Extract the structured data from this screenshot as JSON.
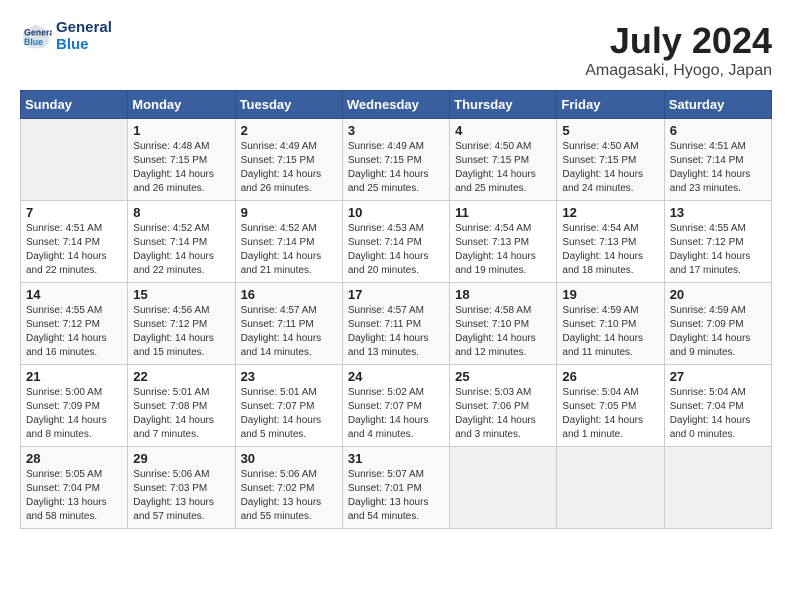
{
  "header": {
    "logo_line1": "General",
    "logo_line2": "Blue",
    "title": "July 2024",
    "location": "Amagasaki, Hyogo, Japan"
  },
  "days_of_week": [
    "Sunday",
    "Monday",
    "Tuesday",
    "Wednesday",
    "Thursday",
    "Friday",
    "Saturday"
  ],
  "weeks": [
    [
      {
        "day": "",
        "sunrise": "",
        "sunset": "",
        "daylight": ""
      },
      {
        "day": "1",
        "sunrise": "Sunrise: 4:48 AM",
        "sunset": "Sunset: 7:15 PM",
        "daylight": "Daylight: 14 hours and 26 minutes."
      },
      {
        "day": "2",
        "sunrise": "Sunrise: 4:49 AM",
        "sunset": "Sunset: 7:15 PM",
        "daylight": "Daylight: 14 hours and 26 minutes."
      },
      {
        "day": "3",
        "sunrise": "Sunrise: 4:49 AM",
        "sunset": "Sunset: 7:15 PM",
        "daylight": "Daylight: 14 hours and 25 minutes."
      },
      {
        "day": "4",
        "sunrise": "Sunrise: 4:50 AM",
        "sunset": "Sunset: 7:15 PM",
        "daylight": "Daylight: 14 hours and 25 minutes."
      },
      {
        "day": "5",
        "sunrise": "Sunrise: 4:50 AM",
        "sunset": "Sunset: 7:15 PM",
        "daylight": "Daylight: 14 hours and 24 minutes."
      },
      {
        "day": "6",
        "sunrise": "Sunrise: 4:51 AM",
        "sunset": "Sunset: 7:14 PM",
        "daylight": "Daylight: 14 hours and 23 minutes."
      }
    ],
    [
      {
        "day": "7",
        "sunrise": "Sunrise: 4:51 AM",
        "sunset": "Sunset: 7:14 PM",
        "daylight": "Daylight: 14 hours and 22 minutes."
      },
      {
        "day": "8",
        "sunrise": "Sunrise: 4:52 AM",
        "sunset": "Sunset: 7:14 PM",
        "daylight": "Daylight: 14 hours and 22 minutes."
      },
      {
        "day": "9",
        "sunrise": "Sunrise: 4:52 AM",
        "sunset": "Sunset: 7:14 PM",
        "daylight": "Daylight: 14 hours and 21 minutes."
      },
      {
        "day": "10",
        "sunrise": "Sunrise: 4:53 AM",
        "sunset": "Sunset: 7:14 PM",
        "daylight": "Daylight: 14 hours and 20 minutes."
      },
      {
        "day": "11",
        "sunrise": "Sunrise: 4:54 AM",
        "sunset": "Sunset: 7:13 PM",
        "daylight": "Daylight: 14 hours and 19 minutes."
      },
      {
        "day": "12",
        "sunrise": "Sunrise: 4:54 AM",
        "sunset": "Sunset: 7:13 PM",
        "daylight": "Daylight: 14 hours and 18 minutes."
      },
      {
        "day": "13",
        "sunrise": "Sunrise: 4:55 AM",
        "sunset": "Sunset: 7:12 PM",
        "daylight": "Daylight: 14 hours and 17 minutes."
      }
    ],
    [
      {
        "day": "14",
        "sunrise": "Sunrise: 4:55 AM",
        "sunset": "Sunset: 7:12 PM",
        "daylight": "Daylight: 14 hours and 16 minutes."
      },
      {
        "day": "15",
        "sunrise": "Sunrise: 4:56 AM",
        "sunset": "Sunset: 7:12 PM",
        "daylight": "Daylight: 14 hours and 15 minutes."
      },
      {
        "day": "16",
        "sunrise": "Sunrise: 4:57 AM",
        "sunset": "Sunset: 7:11 PM",
        "daylight": "Daylight: 14 hours and 14 minutes."
      },
      {
        "day": "17",
        "sunrise": "Sunrise: 4:57 AM",
        "sunset": "Sunset: 7:11 PM",
        "daylight": "Daylight: 14 hours and 13 minutes."
      },
      {
        "day": "18",
        "sunrise": "Sunrise: 4:58 AM",
        "sunset": "Sunset: 7:10 PM",
        "daylight": "Daylight: 14 hours and 12 minutes."
      },
      {
        "day": "19",
        "sunrise": "Sunrise: 4:59 AM",
        "sunset": "Sunset: 7:10 PM",
        "daylight": "Daylight: 14 hours and 11 minutes."
      },
      {
        "day": "20",
        "sunrise": "Sunrise: 4:59 AM",
        "sunset": "Sunset: 7:09 PM",
        "daylight": "Daylight: 14 hours and 9 minutes."
      }
    ],
    [
      {
        "day": "21",
        "sunrise": "Sunrise: 5:00 AM",
        "sunset": "Sunset: 7:09 PM",
        "daylight": "Daylight: 14 hours and 8 minutes."
      },
      {
        "day": "22",
        "sunrise": "Sunrise: 5:01 AM",
        "sunset": "Sunset: 7:08 PM",
        "daylight": "Daylight: 14 hours and 7 minutes."
      },
      {
        "day": "23",
        "sunrise": "Sunrise: 5:01 AM",
        "sunset": "Sunset: 7:07 PM",
        "daylight": "Daylight: 14 hours and 5 minutes."
      },
      {
        "day": "24",
        "sunrise": "Sunrise: 5:02 AM",
        "sunset": "Sunset: 7:07 PM",
        "daylight": "Daylight: 14 hours and 4 minutes."
      },
      {
        "day": "25",
        "sunrise": "Sunrise: 5:03 AM",
        "sunset": "Sunset: 7:06 PM",
        "daylight": "Daylight: 14 hours and 3 minutes."
      },
      {
        "day": "26",
        "sunrise": "Sunrise: 5:04 AM",
        "sunset": "Sunset: 7:05 PM",
        "daylight": "Daylight: 14 hours and 1 minute."
      },
      {
        "day": "27",
        "sunrise": "Sunrise: 5:04 AM",
        "sunset": "Sunset: 7:04 PM",
        "daylight": "Daylight: 14 hours and 0 minutes."
      }
    ],
    [
      {
        "day": "28",
        "sunrise": "Sunrise: 5:05 AM",
        "sunset": "Sunset: 7:04 PM",
        "daylight": "Daylight: 13 hours and 58 minutes."
      },
      {
        "day": "29",
        "sunrise": "Sunrise: 5:06 AM",
        "sunset": "Sunset: 7:03 PM",
        "daylight": "Daylight: 13 hours and 57 minutes."
      },
      {
        "day": "30",
        "sunrise": "Sunrise: 5:06 AM",
        "sunset": "Sunset: 7:02 PM",
        "daylight": "Daylight: 13 hours and 55 minutes."
      },
      {
        "day": "31",
        "sunrise": "Sunrise: 5:07 AM",
        "sunset": "Sunset: 7:01 PM",
        "daylight": "Daylight: 13 hours and 54 minutes."
      },
      {
        "day": "",
        "sunrise": "",
        "sunset": "",
        "daylight": ""
      },
      {
        "day": "",
        "sunrise": "",
        "sunset": "",
        "daylight": ""
      },
      {
        "day": "",
        "sunrise": "",
        "sunset": "",
        "daylight": ""
      }
    ]
  ]
}
